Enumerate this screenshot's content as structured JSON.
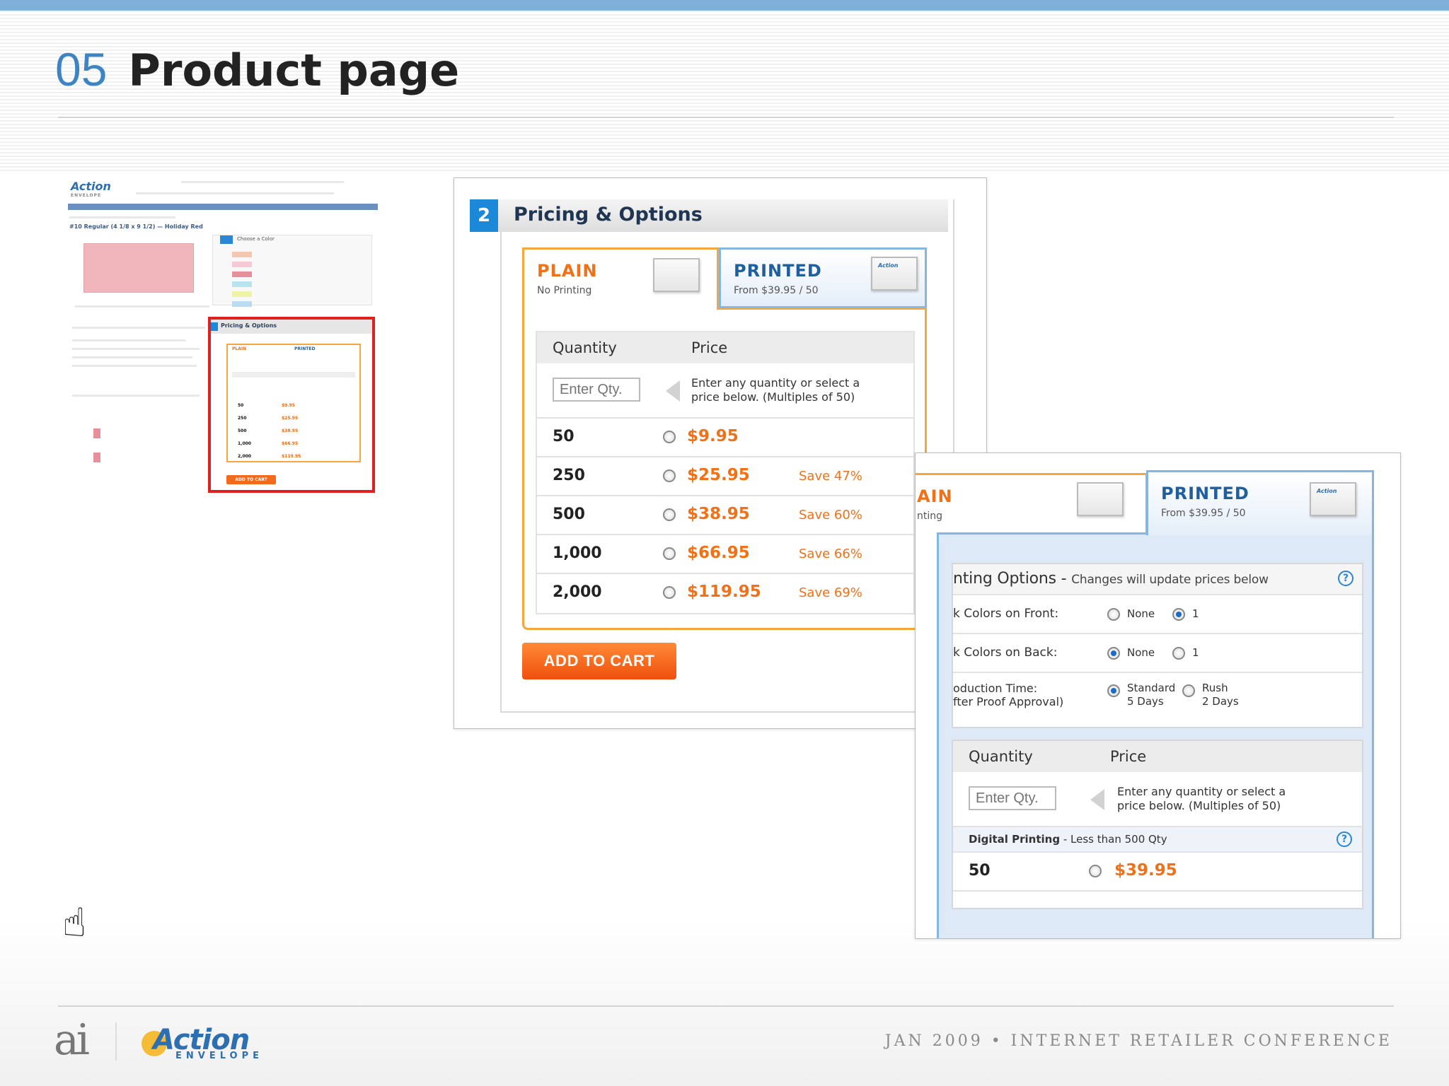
{
  "slide": {
    "number": "05",
    "title": "Product page",
    "footer_right": "JAN 2009 • INTERNET RETAILER CONFERENCE",
    "footer_logo_ai": "ai",
    "footer_logo_brand": "Action",
    "footer_logo_brand_sub": "ENVELOPE"
  },
  "thumbnail": {
    "logo": "Action",
    "logo_sub": "ENVELOPE",
    "product_title": "#10 Regular (4 1/8 x 9 1/2) — Holiday Red",
    "choose_color": "Choose a Color",
    "pricing_title": "Pricing & Options",
    "plain": "PLAIN",
    "printed": "PRINTED",
    "quantities": [
      "50",
      "250",
      "500",
      "1,000",
      "2,000"
    ],
    "prices": [
      "$9.95",
      "$25.95",
      "$38.95",
      "$66.95",
      "$119.95"
    ],
    "add_to_cart": "ADD TO CART"
  },
  "pricing": {
    "step": "2",
    "title": "Pricing & Options",
    "tab_plain": {
      "title": "PLAIN",
      "subtitle": "No Printing"
    },
    "tab_printed": {
      "title": "PRINTED",
      "subtitle": "From $39.95 / 50"
    },
    "col_quantity": "Quantity",
    "col_price": "Price",
    "qty_placeholder": "Enter Qty.",
    "hint_line1": "Enter any quantity or select a",
    "hint_line2": "price below. (Multiples of 50)",
    "rows": [
      {
        "qty": "50",
        "price": "$9.95",
        "save": ""
      },
      {
        "qty": "250",
        "price": "$25.95",
        "save": "Save 47%"
      },
      {
        "qty": "500",
        "price": "$38.95",
        "save": "Save 60%"
      },
      {
        "qty": "1,000",
        "price": "$66.95",
        "save": "Save 66%"
      },
      {
        "qty": "2,000",
        "price": "$119.95",
        "save": "Save 69%"
      }
    ],
    "add_to_cart": "ADD TO CART",
    "env_logo": "Action"
  },
  "printed_view": {
    "tab_plain_title": "AIN",
    "tab_plain_sub": "nting",
    "tab_printed": {
      "title": "PRINTED",
      "subtitle": "From $39.95 / 50"
    },
    "options_title": "nting Options -",
    "options_sub": "Changes will update prices below",
    "help": "?",
    "front_label": "k Colors on Front:",
    "back_label": "k Colors on Back:",
    "opt_none": "None",
    "opt_one": "1",
    "prod_label1": "oduction Time:",
    "prod_label2": "fter Proof Approval)",
    "standard": "Standard",
    "standard_days": "5 Days",
    "rush": "Rush",
    "rush_days": "2 Days",
    "col_quantity": "Quantity",
    "col_price": "Price",
    "qty_placeholder": "Enter Qty.",
    "hint_line1": "Enter any quantity or select a",
    "hint_line2": "price below. (Multiples of 50)",
    "digital_bold": "Digital Printing",
    "digital_rest": " -  Less than 500 Qty",
    "row_qty": "50",
    "row_price": "$39.95",
    "env_logo": "Action"
  }
}
